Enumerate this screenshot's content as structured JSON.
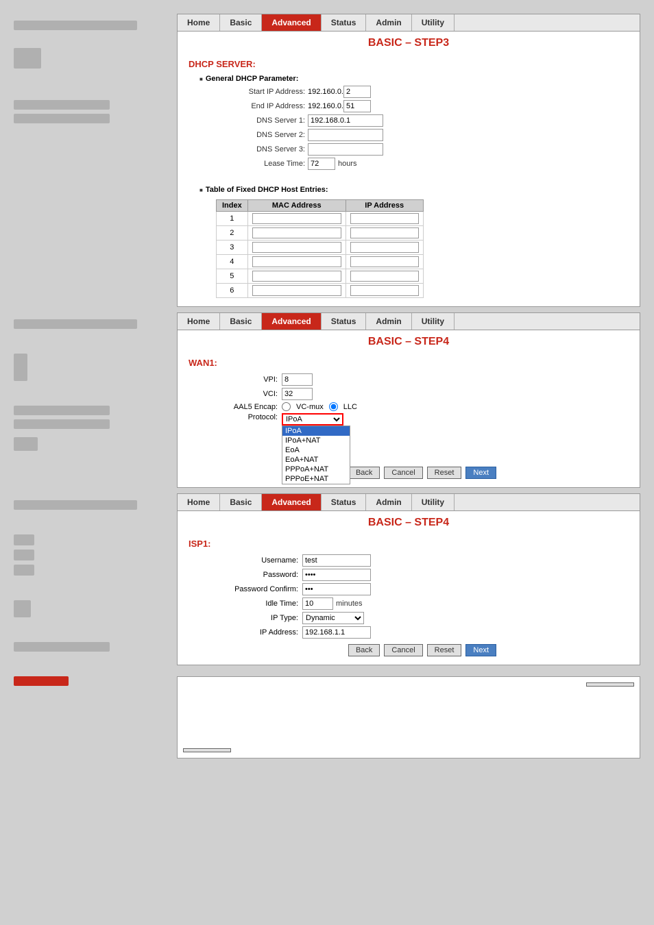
{
  "nav": {
    "items": [
      "Home",
      "Basic",
      "Advanced",
      "Status",
      "Admin",
      "Utility"
    ]
  },
  "panel1": {
    "title": "BASIC – STEP3",
    "section": "DHCP SERVER:",
    "subsection1": "General DHCP Parameter:",
    "fields": {
      "start_ip_label": "Start IP Address:",
      "start_ip_prefix": "192.160.0.",
      "start_ip_value": "2",
      "end_ip_label": "End IP Address:",
      "end_ip_prefix": "192.160.0.",
      "end_ip_value": "51",
      "dns1_label": "DNS Server 1:",
      "dns1_value": "192.168.0.1",
      "dns2_label": "DNS Server 2:",
      "dns2_value": "",
      "dns3_label": "DNS Server 3:",
      "dns3_value": "",
      "lease_label": "Lease Time:",
      "lease_value": "72",
      "lease_unit": "hours"
    },
    "subsection2": "Table of Fixed DHCP Host Entries:",
    "table": {
      "headers": [
        "Index",
        "MAC Address",
        "IP Address"
      ],
      "rows": [
        1,
        2,
        3,
        4,
        5,
        6
      ]
    }
  },
  "panel2": {
    "title": "BASIC – STEP4",
    "section": "WAN1:",
    "fields": {
      "vpi_label": "VPI:",
      "vpi_value": "8",
      "vci_label": "VCI:",
      "vci_value": "32",
      "aal5_label": "AAL5 Encap:",
      "aal5_vc_mux": "VC-mux",
      "aal5_llc": "LLC",
      "protocol_label": "Protocol:",
      "protocol_value": "IPoA"
    },
    "dropdown_items": [
      "IPoA",
      "IPoA+NAT",
      "EoA",
      "EoA+NAT",
      "PPPoA+NAT",
      "PPPoE+NAT"
    ],
    "buttons": [
      "Back",
      "Cancel",
      "Reset",
      "Next"
    ]
  },
  "panel3": {
    "title": "BASIC – STEP4",
    "section": "ISP1:",
    "fields": {
      "username_label": "Username:",
      "username_value": "test",
      "password_label": "Password:",
      "password_value": "****",
      "confirm_label": "Password Confirm:",
      "confirm_value": "***",
      "idle_label": "Idle Time:",
      "idle_value": "10",
      "idle_unit": "minutes",
      "ip_type_label": "IP Type:",
      "ip_type_value": "Dynamic",
      "ip_addr_label": "IP Address:",
      "ip_addr_value": "192.168.1.1"
    },
    "buttons": [
      "Back",
      "Cancel",
      "Reset",
      "Next"
    ]
  },
  "sidebar_bars": {
    "bar1": "",
    "bar2": "",
    "bar3": "",
    "bar4": ""
  },
  "bottom": {
    "bar_label": "",
    "btn_right_label": "",
    "btn_left_label": ""
  }
}
